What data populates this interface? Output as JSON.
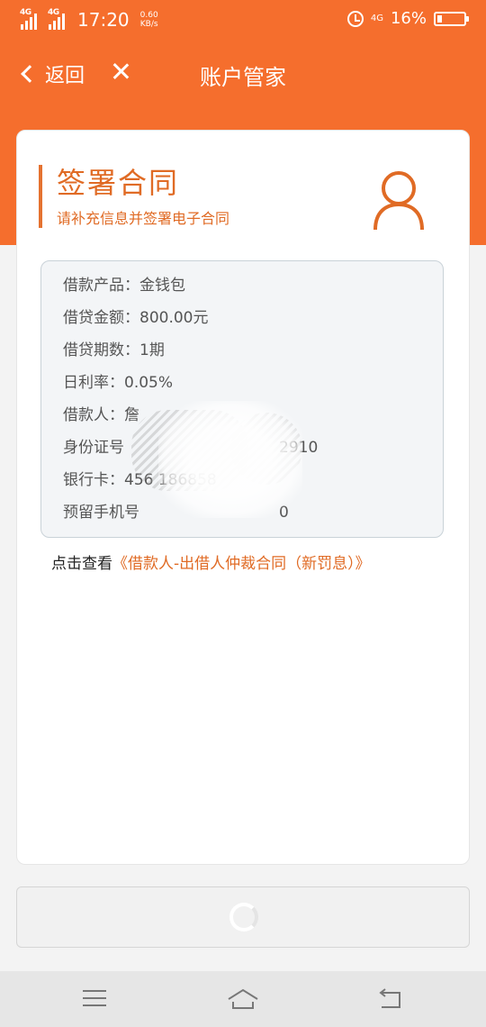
{
  "status_bar": {
    "sim1": "4G",
    "sim2": "4G",
    "time": "17:20",
    "speed_value": "0.60",
    "speed_unit": "KB/s",
    "network": "4G",
    "battery": "16%"
  },
  "nav": {
    "back_label": "返回",
    "title": "账户管家"
  },
  "card": {
    "title": "签署合同",
    "subtitle": "请补充信息并签署电子合同"
  },
  "info": {
    "rows": [
      {
        "label": "借款产品：",
        "value": "金钱包"
      },
      {
        "label": "借贷金额：",
        "value": "800.00元"
      },
      {
        "label": "借贷期数：",
        "value": "1期"
      },
      {
        "label": "日利率：",
        "value": "0.05%"
      },
      {
        "label": "借款人：",
        "value": "詹"
      },
      {
        "label": "身份证号",
        "value": "2910"
      },
      {
        "label": "银行卡：",
        "value": "456 186858"
      },
      {
        "label": "预留手机号",
        "value": "0"
      }
    ]
  },
  "contract": {
    "prefix": "点击查看",
    "link": "《借款人-出借人仲裁合同（新罚息）》"
  },
  "colors": {
    "brand": "#f56e2d",
    "accent_text": "#e06b25"
  }
}
